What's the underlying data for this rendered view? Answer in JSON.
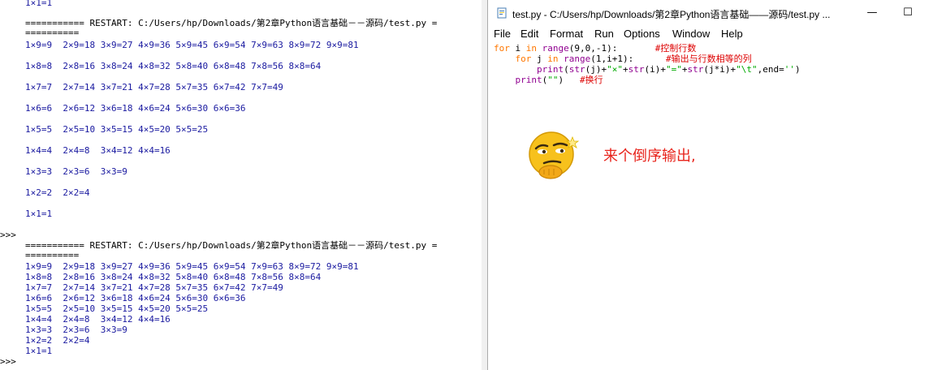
{
  "shell": {
    "prompt": ">>>",
    "first_line": "1×1=1",
    "restart_1": "=========== RESTART: C:/Users/hp/Downloads/第2章Python语言基础－－源码/test.py =",
    "restart_1b": "==========",
    "run1": [
      "1×9=9  2×9=18 3×9=27 4×9=36 5×9=45 6×9=54 7×9=63 8×9=72 9×9=81",
      "1×8=8  2×8=16 3×8=24 4×8=32 5×8=40 6×8=48 7×8=56 8×8=64",
      "1×7=7  2×7=14 3×7=21 4×7=28 5×7=35 6×7=42 7×7=49",
      "1×6=6  2×6=12 3×6=18 4×6=24 5×6=30 6×6=36",
      "1×5=5  2×5=10 3×5=15 4×5=20 5×5=25",
      "1×4=4  2×4=8  3×4=12 4×4=16",
      "1×3=3  2×3=6  3×3=9",
      "1×2=2  2×2=4",
      "1×1=1"
    ],
    "restart_2": "=========== RESTART: C:/Users/hp/Downloads/第2章Python语言基础－－源码/test.py =",
    "restart_2b": "==========",
    "run2": [
      "1×9=9  2×9=18 3×9=27 4×9=36 5×9=45 6×9=54 7×9=63 8×9=72 9×9=81",
      "1×8=8  2×8=16 3×8=24 4×8=32 5×8=40 6×8=48 7×8=56 8×8=64",
      "1×7=7  2×7=14 3×7=21 4×7=28 5×7=35 6×7=42 7×7=49",
      "1×6=6  2×6=12 3×6=18 4×6=24 5×6=30 6×6=36",
      "1×5=5  2×5=10 3×5=15 4×5=20 5×5=25",
      "1×4=4  2×4=8  3×4=12 4×4=16",
      "1×3=3  2×3=6  3×3=9",
      "1×2=2  2×2=4",
      "1×1=1"
    ]
  },
  "editor": {
    "title": "test.py - C:/Users/hp/Downloads/第2章Python语言基础——源码/test.py ...",
    "window_buttons": {
      "minimize": "—",
      "maximize": "☐",
      "close": "✕"
    },
    "menu": [
      "File",
      "Edit",
      "Format",
      "Run",
      "Options",
      "Window",
      "Help"
    ],
    "code": {
      "l1_kw1": "for",
      "l1_a": " i ",
      "l1_kw2": "in",
      "l1_sp": " ",
      "l1_bi": "range",
      "l1_b": "(9,0,-1):",
      "l1_cm": "#控制行数",
      "l2_kw1": "for",
      "l2_a": " j ",
      "l2_kw2": "in",
      "l2_sp": " ",
      "l2_bi": "range",
      "l2_b": "(1,i+1):",
      "l2_cm": "#输出与行数相等的列",
      "l3_bi1": "print",
      "l3_a": "(",
      "l3_bi2": "str",
      "l3_b": "(j)+",
      "l3_s1": "\"×\"",
      "l3_c": "+",
      "l3_bi3": "str",
      "l3_d": "(i)+",
      "l3_s2": "\"=\"",
      "l3_e": "+",
      "l3_bi4": "str",
      "l3_f": "(j*i)+",
      "l3_s3": "\"\\t\"",
      "l3_g": ",end=",
      "l3_s4": "''",
      "l3_h": ")",
      "l4_bi": "print",
      "l4_a": "(",
      "l4_s": "\"\"",
      "l4_b": ")",
      "l4_cm": "#换行"
    }
  },
  "annotation": {
    "emoji": "smirking-face-emoji",
    "comment": "来个倒序输出,"
  },
  "colors": {
    "keyword": "#ff7700",
    "builtin": "#900090",
    "string": "#00aa00",
    "comment": "#dd0000",
    "output": "#1a1aa0",
    "annotation": "#e8241c"
  }
}
